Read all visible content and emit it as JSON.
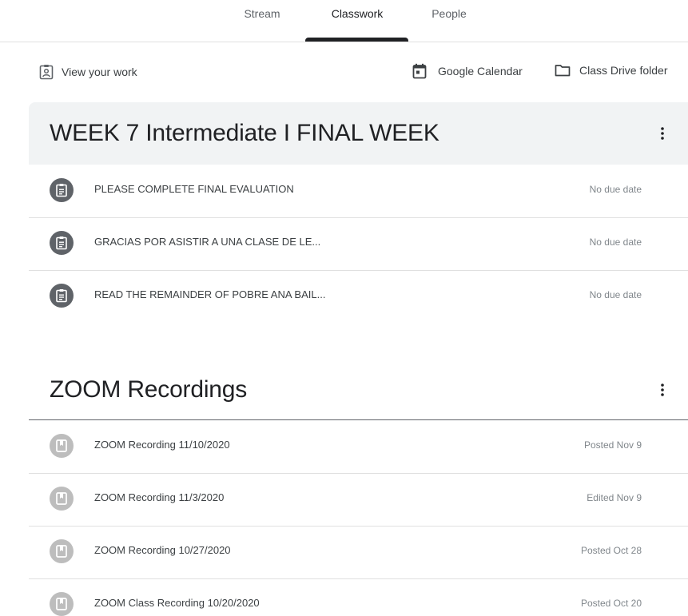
{
  "tabs": {
    "stream": "Stream",
    "classwork": "Classwork",
    "people": "People",
    "active": "Classwork"
  },
  "toolbar": {
    "view_your_work": "View your work",
    "google_calendar": "Google Calendar",
    "class_drive_folder": "Class Drive folder"
  },
  "topics": [
    {
      "title": "WEEK 7 Intermediate I FINAL WEEK",
      "items": [
        {
          "icon": "assignment-icon",
          "title": "PLEASE COMPLETE FINAL EVALUATION",
          "date": "No due date"
        },
        {
          "icon": "assignment-icon",
          "title": "GRACIAS POR ASISTIR A UNA CLASE DE LE...",
          "date": "No due date"
        },
        {
          "icon": "assignment-icon",
          "title": "READ THE REMAINDER OF POBRE ANA BAIL...",
          "date": "No due date"
        }
      ]
    },
    {
      "title": "ZOOM Recordings",
      "items": [
        {
          "icon": "material-icon",
          "title": "ZOOM Recording 11/10/2020",
          "date": "Posted Nov 9"
        },
        {
          "icon": "material-icon",
          "title": "ZOOM Recording 11/3/2020",
          "date": "Edited Nov 9"
        },
        {
          "icon": "material-icon",
          "title": "ZOOM Recording 10/27/2020",
          "date": "Posted Oct 28"
        },
        {
          "icon": "material-icon",
          "title": "ZOOM Class Recording 10/20/2020",
          "date": "Posted Oct 20"
        }
      ]
    }
  ],
  "colors": {
    "active_tab_indicator": "#202124",
    "topic_header_bg": "#f1f3f4",
    "assignment_icon_bg": "#5f6368",
    "material_icon_bg": "#bdbdbd"
  }
}
